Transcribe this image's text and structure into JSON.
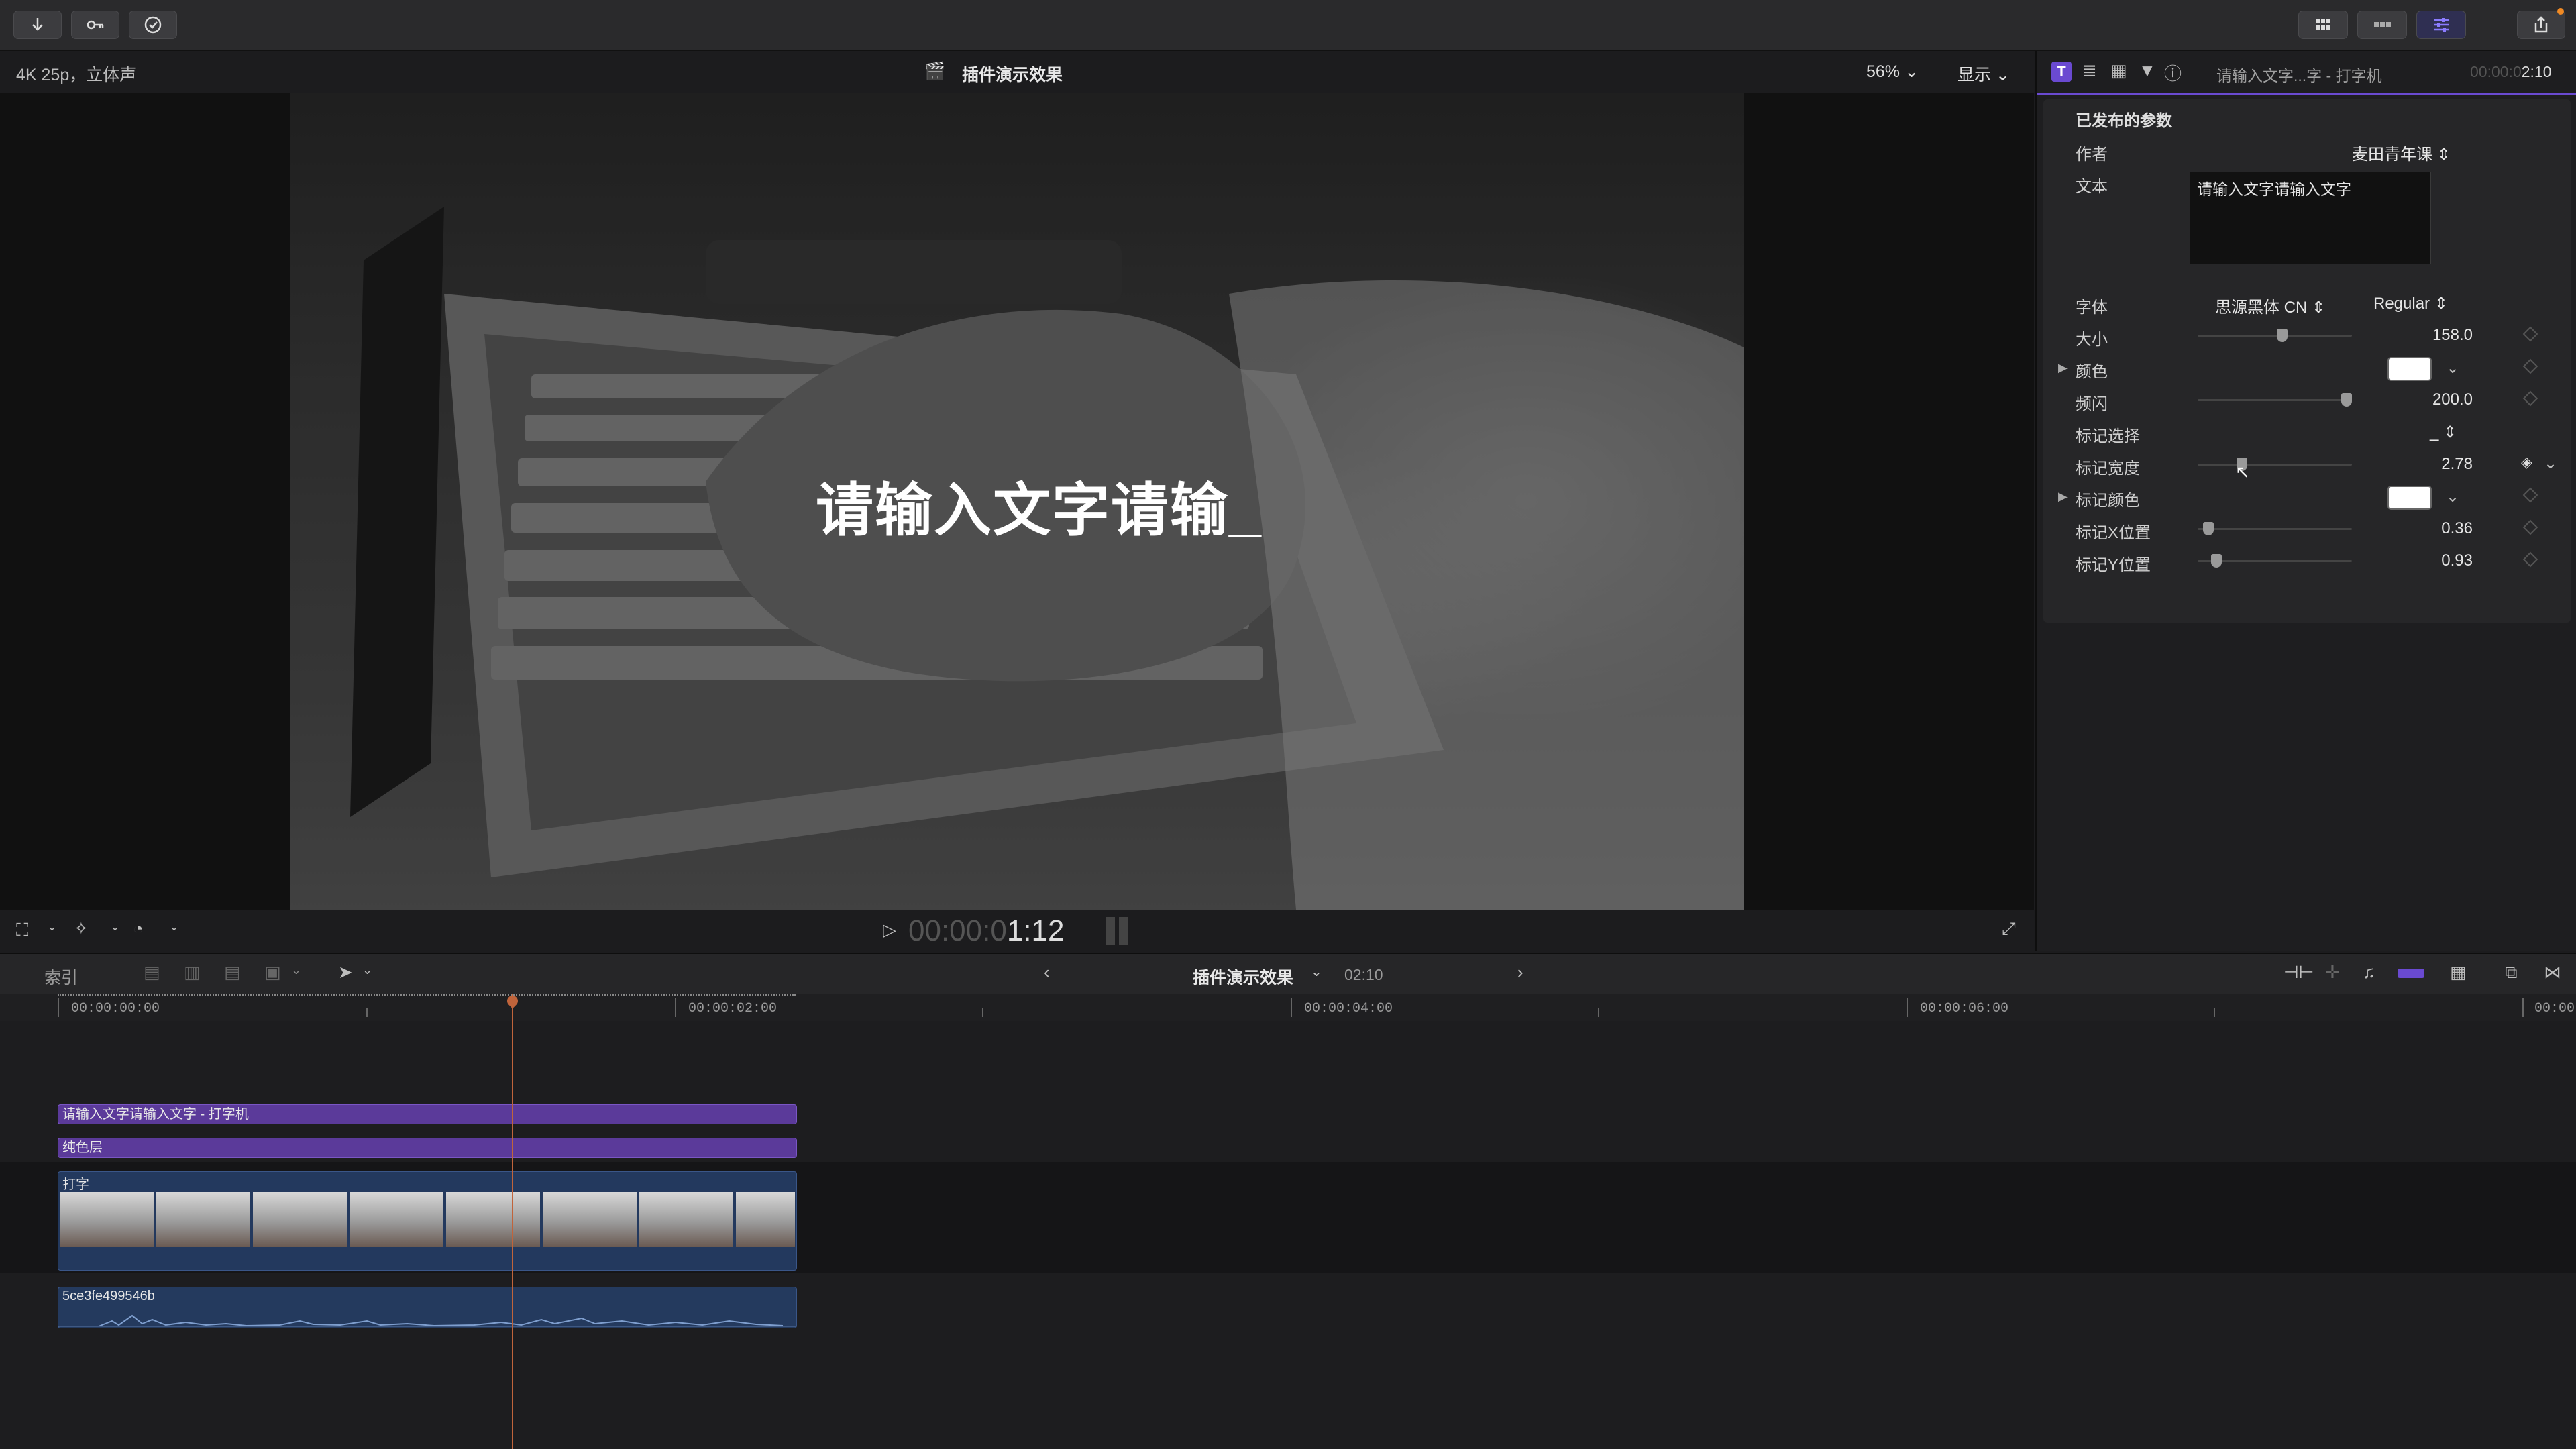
{
  "viewer": {
    "format_label": "4K 25p，立体声",
    "project_title": "插件演示效果",
    "zoom": "56%",
    "display_menu": "显示",
    "overlay_text": "请输入文字请输_",
    "timecode_dim": "00:00:0",
    "timecode_bright": "1:12"
  },
  "inspector": {
    "title_text": "请输入文字...字 - 打字机",
    "duration_dim": "00:00:0",
    "duration_bright": "2:10",
    "section": "已发布的参数",
    "author_label": "作者",
    "author_value": "麦田青年课",
    "text_label": "文本",
    "text_value": "请输入文字请输入文字",
    "font_label": "字体",
    "font_family": "思源黑体 CN",
    "font_style": "Regular",
    "size_label": "大小",
    "size_value": "158.0",
    "color_label": "颜色",
    "blink_label": "频闪",
    "blink_value": "200.0",
    "marker_select_label": "标记选择",
    "marker_select_value": "_",
    "marker_width_label": "标记宽度",
    "marker_width_value": "2.78",
    "marker_color_label": "标记颜色",
    "marker_x_label": "标记X位置",
    "marker_x_value": "0.36",
    "marker_y_label": "标记Y位置",
    "marker_y_value": "0.93"
  },
  "timeline_bar": {
    "index_label": "索引",
    "project_name": "插件演示效果",
    "duration": "02:10"
  },
  "ruler": [
    "00:00:00:00",
    "00:00:02:00",
    "00:00:04:00",
    "00:00:06:00",
    "00:00"
  ],
  "clips": {
    "title_clip": "请输入文字请输入文字 - 打字机",
    "solid_clip": "纯色层",
    "video_clip": "打字",
    "audio_clip": "5ce3fe499546b"
  },
  "colors": {
    "accent_purple": "#6a4ad1",
    "title_clip": "#5b3a9a",
    "video_clip": "#23395e",
    "playhead": "#c0643b"
  }
}
